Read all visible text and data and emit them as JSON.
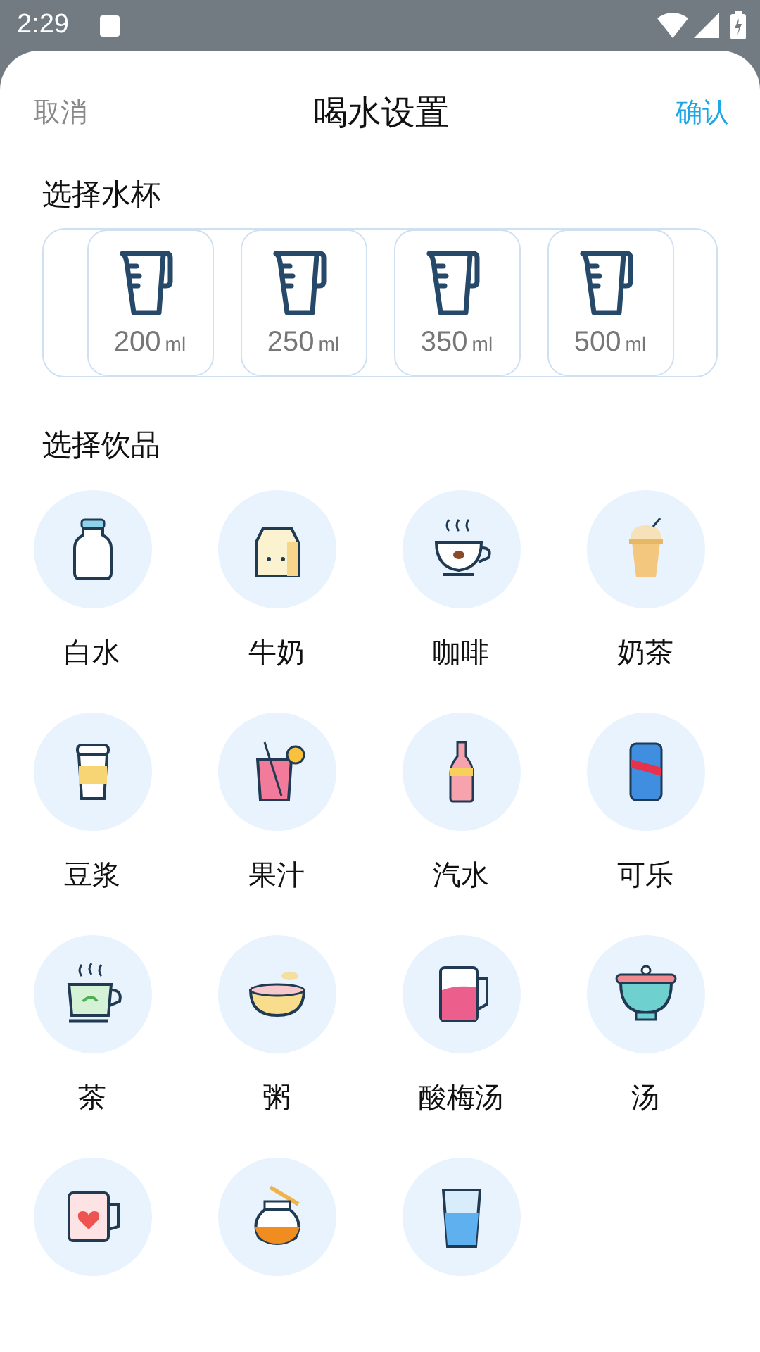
{
  "status_bar": {
    "time": "2:29"
  },
  "header": {
    "cancel": "取消",
    "title": "喝水设置",
    "confirm": "确认"
  },
  "cups_section": {
    "title": "选择水杯",
    "cups": [
      {
        "amount": "200",
        "unit": "ml"
      },
      {
        "amount": "250",
        "unit": "ml"
      },
      {
        "amount": "350",
        "unit": "ml"
      },
      {
        "amount": "500",
        "unit": "ml"
      }
    ]
  },
  "drinks_section": {
    "title": "选择饮品",
    "drinks": [
      {
        "kind": "bottle",
        "label": "白水"
      },
      {
        "kind": "carton",
        "label": "牛奶"
      },
      {
        "kind": "coffee",
        "label": "咖啡"
      },
      {
        "kind": "milktea",
        "label": "奶茶"
      },
      {
        "kind": "takeaway",
        "label": "豆浆"
      },
      {
        "kind": "juice",
        "label": "果汁"
      },
      {
        "kind": "soda",
        "label": "汽水"
      },
      {
        "kind": "can",
        "label": "可乐"
      },
      {
        "kind": "teacup",
        "label": "茶"
      },
      {
        "kind": "bowl",
        "label": "粥"
      },
      {
        "kind": "mug",
        "label": "酸梅汤"
      },
      {
        "kind": "pot",
        "label": "汤"
      },
      {
        "kind": "heartmug"
      },
      {
        "kind": "honey"
      },
      {
        "kind": "glass"
      }
    ]
  }
}
